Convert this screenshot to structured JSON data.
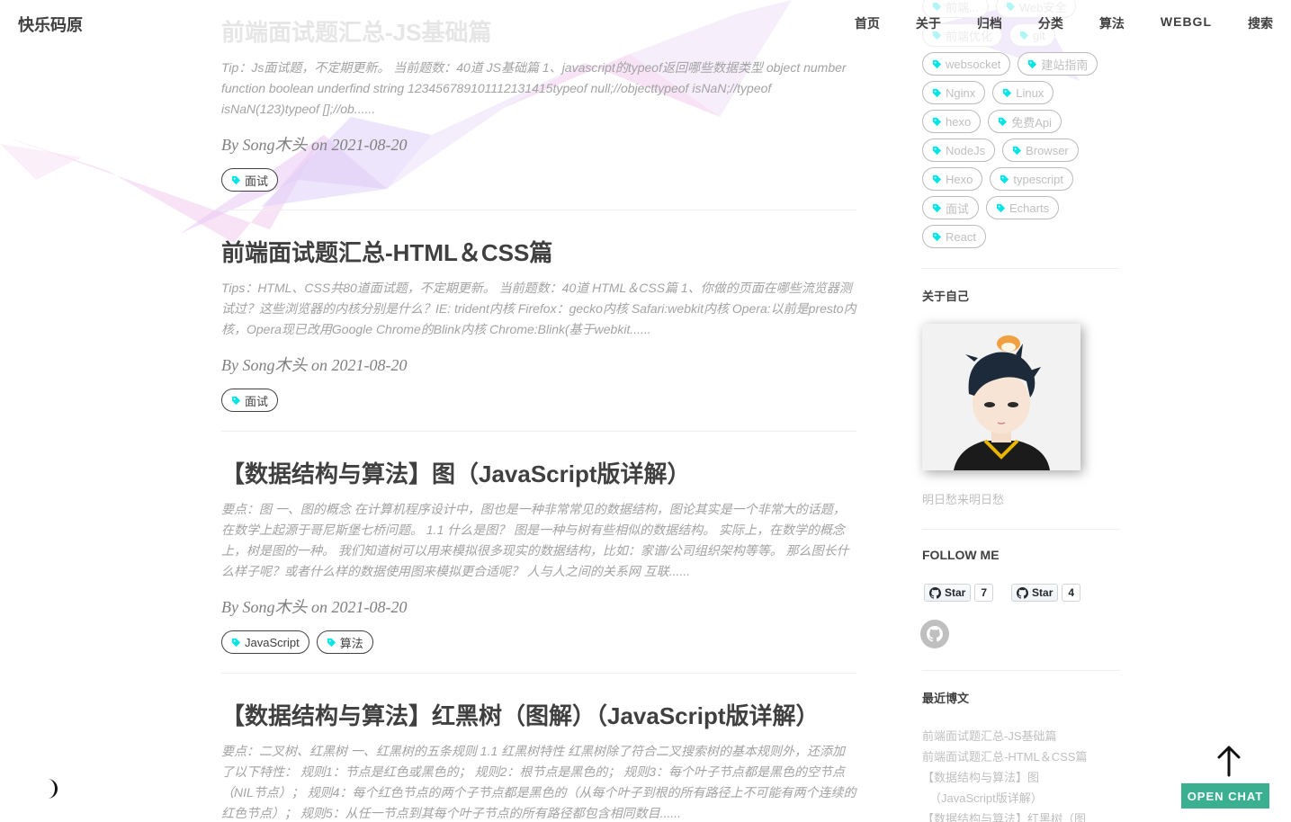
{
  "brand": "快乐码原",
  "nav": [
    "首页",
    "关于",
    "归档",
    "分类",
    "算法",
    "WEBGL",
    "搜索"
  ],
  "posts": [
    {
      "title": "前端面试题汇总-JS基础篇",
      "excerpt": "Tip：Js面试题，不定期更新。 当前题数：40道 JS基础篇 1、javascript的typeof返回哪些数据类型 object number function boolean underfind string 123456789101112131415typeof null;//objecttypeof isNaN;//typeof isNaN(123)typeof [];//ob......",
      "meta": "By Song木头 on 2021-08-20",
      "tags": [
        "面试"
      ]
    },
    {
      "title": "前端面试题汇总-HTML＆CSS篇",
      "excerpt": "Tips：HTML、CSS共80道面试题，不定期更新。 当前题数：40道 HTML＆CSS篇 1、你做的页面在哪些流览器测试过？这些浏览器的内核分别是什么？IE: trident内核 Firefox：gecko内核 Safari:webkit内核 Opera:以前是presto内核，Opera现已改用Google Chrome的Blink内核 Chrome:Blink(基于webkit......",
      "meta": "By Song木头 on 2021-08-20",
      "tags": [
        "面试"
      ]
    },
    {
      "title": "【数据结构与算法】图（JavaScript版详解）",
      "excerpt": "要点：图 一、图的概念 在计算机程序设计中，图也是一种非常常见的数据结构，图论其实是一个非常大的话题，在数学上起源于哥尼斯堡七桥问题。 1.1 什么是图？ 图是一种与树有些相似的数据结构。 实际上，在数学的概念上，树是图的一种。 我们知道树可以用来模拟很多现实的数据结构，比如：家谱/公司组织架构等等。 那么图长什么样子呢？或者什么样的数据使用图来模拟更合适呢？ 人与人之间的关系网 互联......",
      "meta": "By Song木头 on 2021-08-20",
      "tags": [
        "JavaScript",
        "算法"
      ]
    },
    {
      "title": "【数据结构与算法】红黑树（图解）（JavaScript版详解）",
      "excerpt": "要点：二叉树、红黑树 一、红黑树的五条规则 1.1 红黑树特性 红黑树除了符合二叉搜索树的基本规则外，还添加了以下特性： 规则1：节点是红色或黑色的； 规则2：根节点是黑色的； 规则3：每个叶子节点都是黑色的空节点（NIL节点）； 规则4：每个红色节点的两个子节点都是黑色的（从每个叶子到根的所有路径上不可能有两个连续的红色节点）； 规则5：从任一节点到其每个叶子节点的所有路径都包含相同数目......",
      "meta": "",
      "tags": []
    }
  ],
  "sidebar": {
    "tags_partial": [
      "前端...",
      "Web安全",
      "前端优化",
      "git"
    ],
    "tags": [
      "websocket",
      "建站指南",
      "Nginx",
      "Linux",
      "hexo",
      "免费Api",
      "NodeJs",
      "Browser",
      "Hexo",
      "typescript",
      "面试",
      "Echarts",
      "React"
    ],
    "about_title": "关于自己",
    "about_text": "明日愁来明日愁",
    "follow_title": "FOLLOW ME",
    "github": [
      {
        "label": "Star",
        "count": "7"
      },
      {
        "label": "Star",
        "count": "4"
      }
    ],
    "recent_title": "最近博文",
    "recent": [
      "前端面试题汇总-JS基础篇",
      "前端面试题汇总-HTML＆CSS篇",
      "【数据结构与算法】图",
      "（JavaScript版详解）",
      "【数据结构与算法】红黑树（图"
    ]
  },
  "chat_label": "OPEN CHAT",
  "colors": {
    "tag_icon": "#00e5e5",
    "chat": "#3ab090",
    "ribbon_pink": "#f0b8f0",
    "ribbon_lavender": "#d8c8f4"
  },
  "icons": {
    "tag": "tag-icon",
    "moon": "moon-icon",
    "back_to_top": "arrow-up-icon",
    "github": "github-icon"
  }
}
